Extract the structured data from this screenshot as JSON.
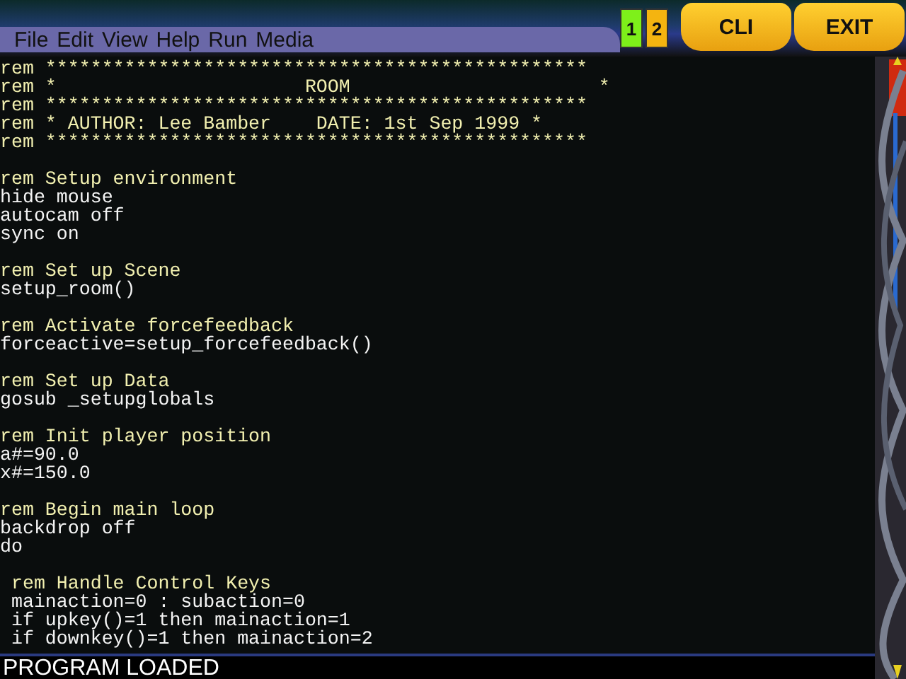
{
  "menu": [
    "File",
    "Edit",
    "View",
    "Help",
    "Run",
    "Media"
  ],
  "screens": [
    {
      "label": "1",
      "selected": true
    },
    {
      "label": "2",
      "selected": false
    }
  ],
  "buttons": [
    "CLI",
    "EXIT"
  ],
  "editor": {
    "lines": [
      {
        "kind": "comment",
        "text": "rem ************************************************"
      },
      {
        "kind": "comment",
        "text": "rem *                      ROOM                      *"
      },
      {
        "kind": "comment",
        "text": "rem ************************************************"
      },
      {
        "kind": "comment",
        "text": "rem * AUTHOR: Lee Bamber    DATE: 1st Sep 1999 *"
      },
      {
        "kind": "comment",
        "text": "rem ************************************************"
      },
      {
        "kind": "blank"
      },
      {
        "kind": "comment",
        "text": "rem Setup environment"
      },
      {
        "kind": "code",
        "text": "hide mouse"
      },
      {
        "kind": "code",
        "text": "autocam off"
      },
      {
        "kind": "code",
        "text": "sync on"
      },
      {
        "kind": "blank"
      },
      {
        "kind": "comment",
        "text": "rem Set up Scene"
      },
      {
        "kind": "code",
        "text": "setup_room()"
      },
      {
        "kind": "blank"
      },
      {
        "kind": "comment",
        "text": "rem Activate forcefeedback"
      },
      {
        "kind": "code",
        "text": "forceactive=setup_forcefeedback()"
      },
      {
        "kind": "blank"
      },
      {
        "kind": "comment",
        "text": "rem Set up Data"
      },
      {
        "kind": "code",
        "text": "gosub _setupglobals"
      },
      {
        "kind": "blank"
      },
      {
        "kind": "comment",
        "text": "rem Init player position"
      },
      {
        "kind": "code",
        "text": "a#=90.0"
      },
      {
        "kind": "code",
        "text": "x#=150.0"
      },
      {
        "kind": "blank"
      },
      {
        "kind": "comment",
        "text": "rem Begin main loop"
      },
      {
        "kind": "code",
        "text": "backdrop off"
      },
      {
        "kind": "code",
        "text": "do"
      },
      {
        "kind": "blank"
      },
      {
        "kind": "comment",
        "text": " rem Handle Control Keys"
      },
      {
        "kind": "code",
        "text": " mainaction=0 : subaction=0"
      },
      {
        "kind": "code",
        "text": " if upkey()=1 then mainaction=1"
      },
      {
        "kind": "code",
        "text": " if downkey()=1 then mainaction=2"
      }
    ]
  },
  "status_bar": "PROGRAM LOADED"
}
